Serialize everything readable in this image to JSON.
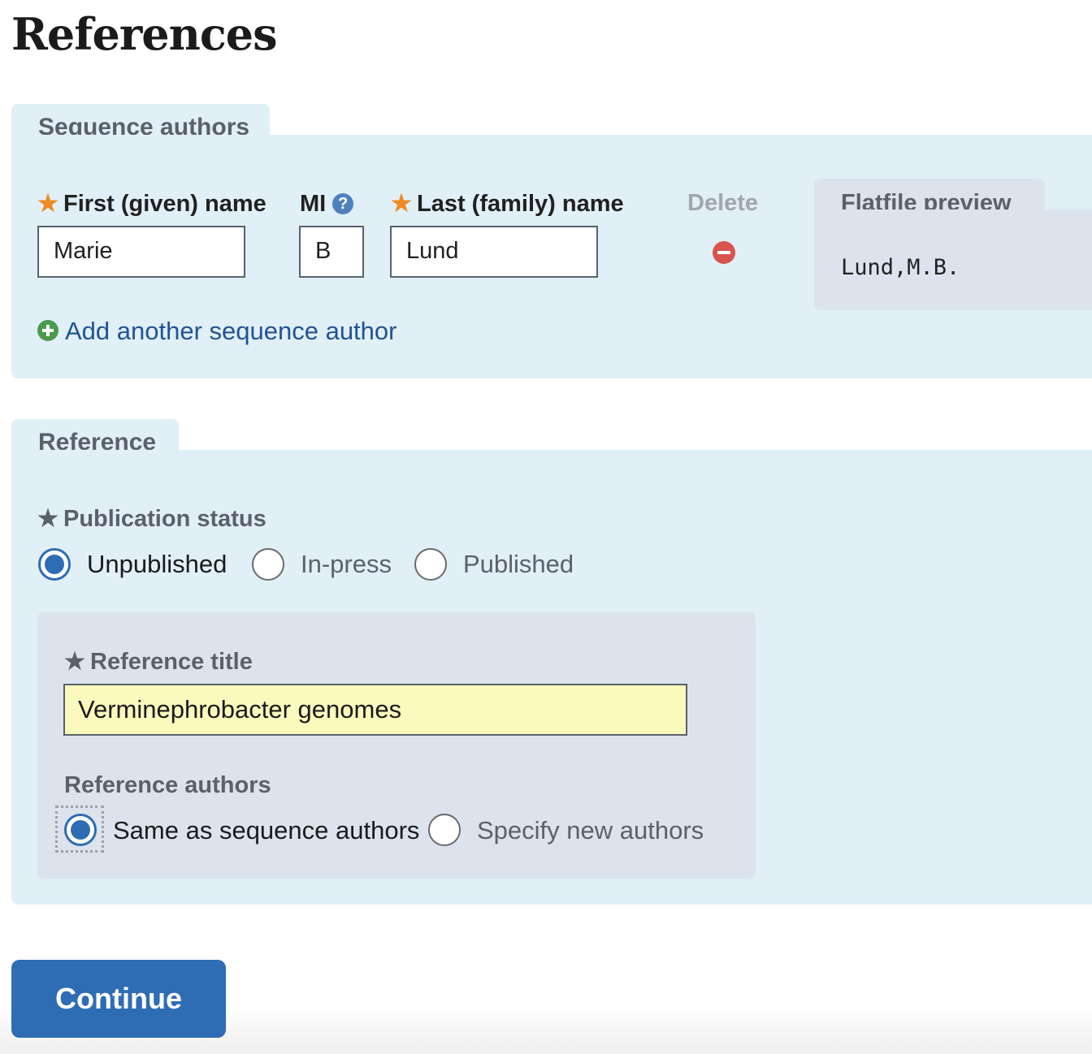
{
  "page": {
    "title": "References"
  },
  "sequence_authors": {
    "heading": "Sequence authors",
    "first_name_label": "First (given) name",
    "mi_label": "MI",
    "mi_help": "?",
    "last_name_label": "Last (family) name",
    "delete_label": "Delete",
    "author": {
      "first": "Marie",
      "mi": "B",
      "last": "Lund"
    },
    "add_author_link": "Add another sequence author",
    "preview": {
      "heading": "Flatfile preview",
      "text": "Lund,M.B."
    },
    "required_star": "★"
  },
  "reference": {
    "heading": "Reference",
    "publication_status": {
      "label": "Publication status",
      "options": [
        "Unpublished",
        "In-press",
        "Published"
      ],
      "selected": "Unpublished"
    },
    "title_label": "Reference title",
    "title_value": "Verminephrobacter genomes",
    "authors_label": "Reference authors",
    "authors_options": [
      "Same as sequence authors",
      "Specify new authors"
    ],
    "authors_selected": "Same as sequence authors"
  },
  "actions": {
    "continue_label": "Continue"
  },
  "colors": {
    "panel_bg": "#e1eff7",
    "inner_bg": "#dce3ed",
    "accent": "#2e6db4",
    "required": "#f08a24",
    "delete": "#d9534f",
    "add": "#4c9a4e",
    "title_input_bg": "#fafabd"
  }
}
